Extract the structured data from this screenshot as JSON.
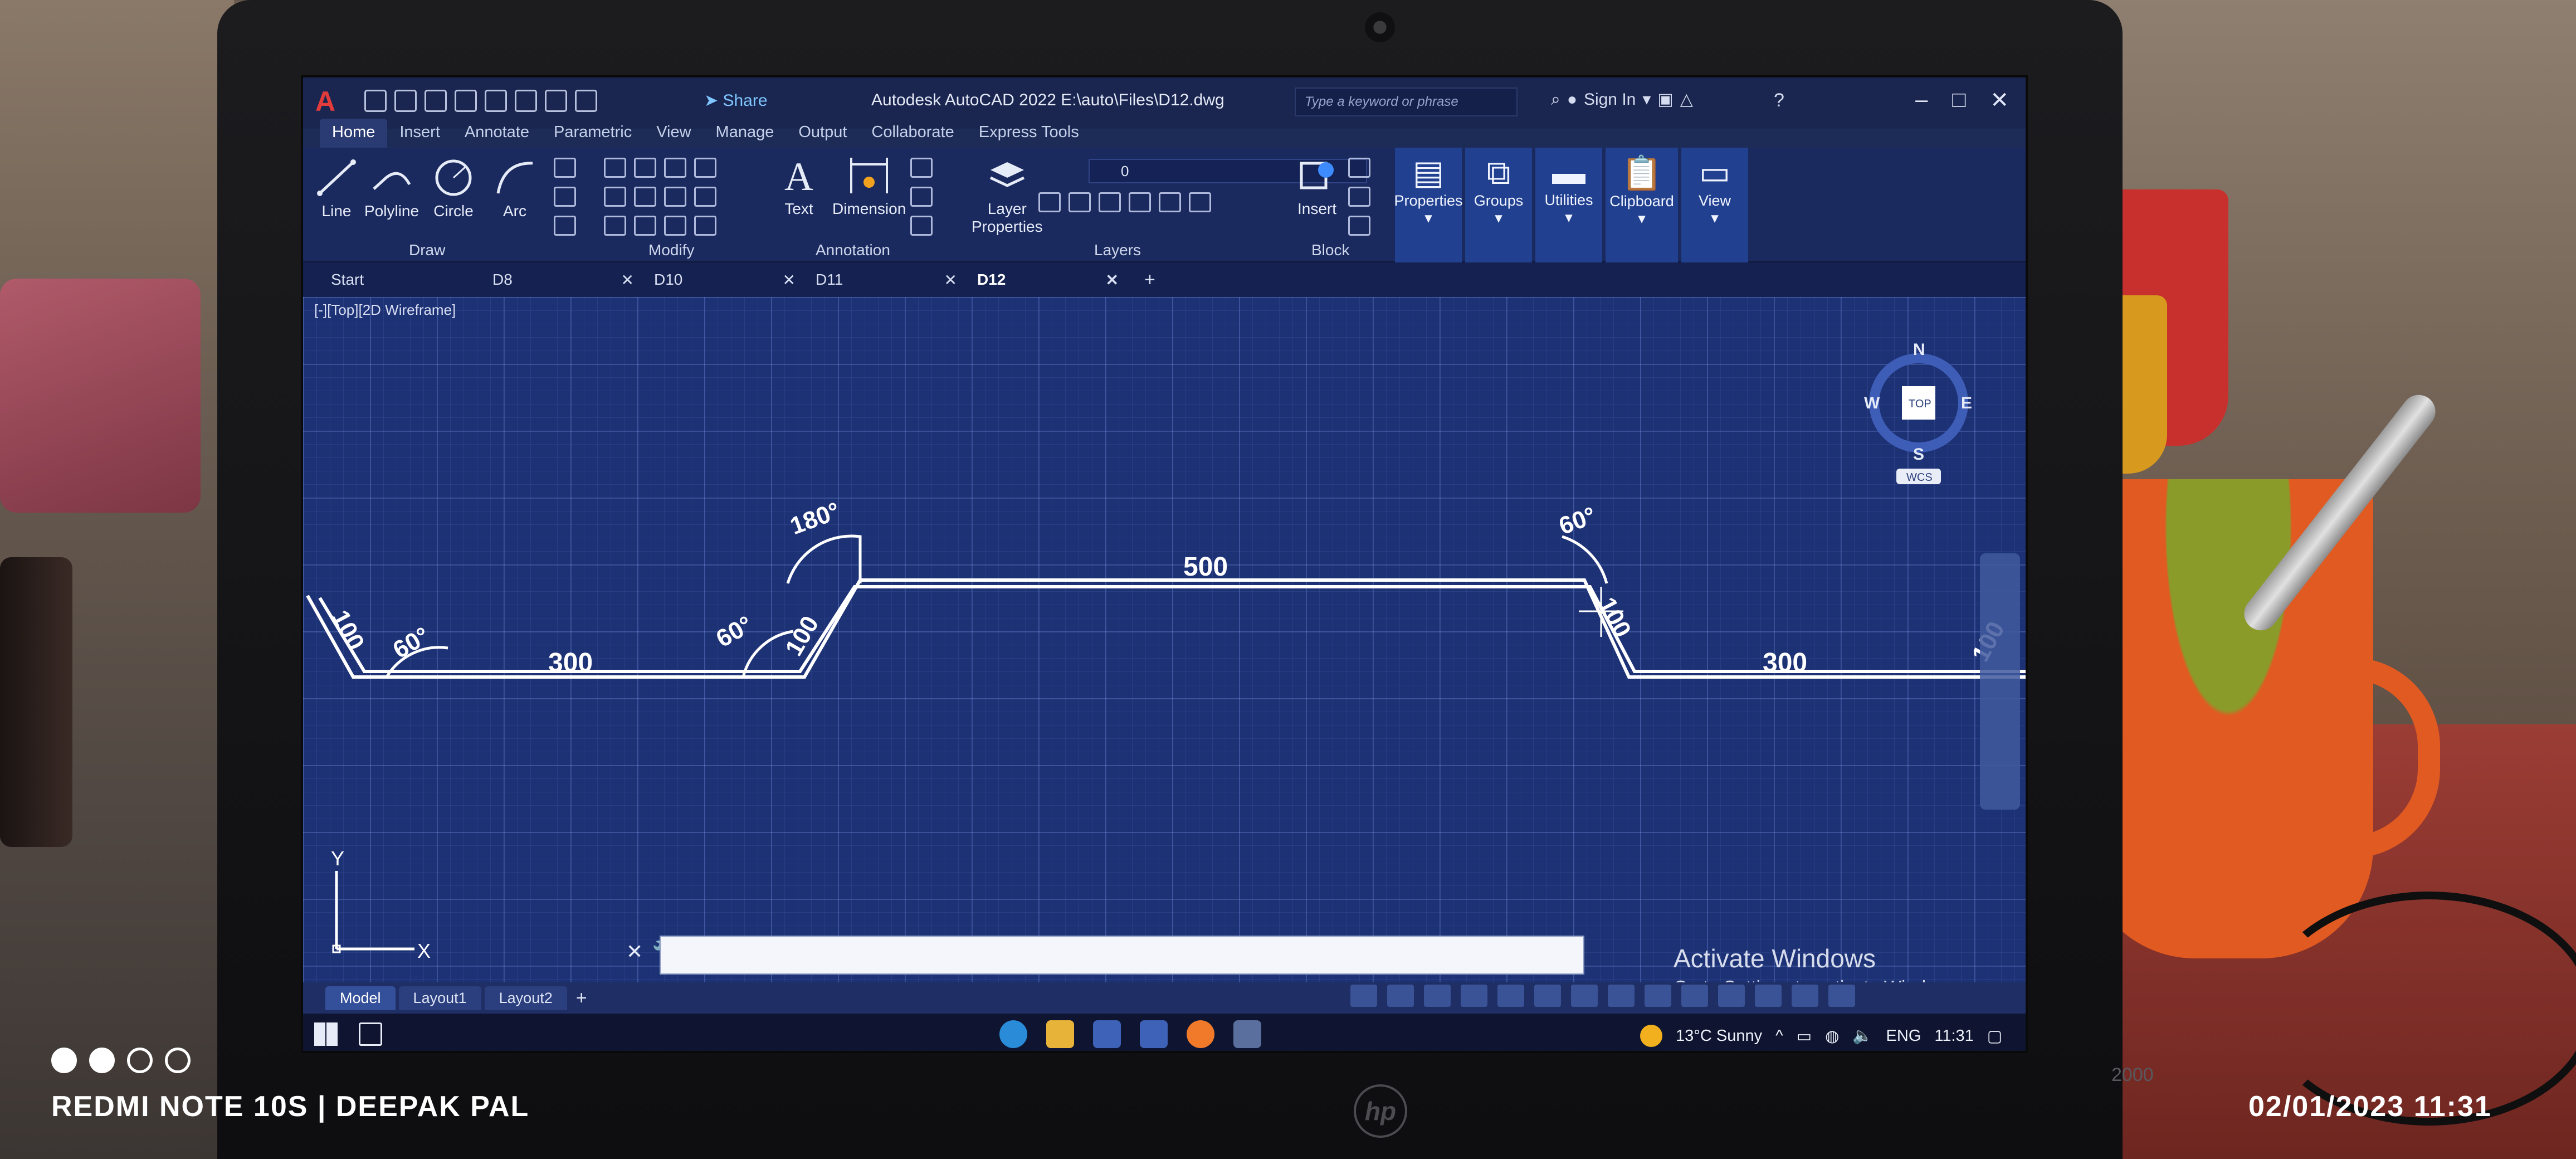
{
  "app": {
    "title": "Autodesk AutoCAD 2022   E:\\auto\\Files\\D12.dwg",
    "share_label": "Share",
    "search_placeholder": "Type a keyword or phrase",
    "signin_label": "Sign In"
  },
  "ribbon_tabs": [
    "Home",
    "Insert",
    "Annotate",
    "Parametric",
    "View",
    "Manage",
    "Output",
    "Collaborate",
    "Express Tools"
  ],
  "ribbon": {
    "draw": {
      "line": "Line",
      "polyline": "Polyline",
      "circle": "Circle",
      "arc": "Arc",
      "panel": "Draw"
    },
    "modify_panel": "Modify",
    "annotation": {
      "text": "Text",
      "dimension": "Dimension",
      "panel": "Annotation"
    },
    "layers": {
      "properties_line1": "Layer",
      "properties_line2": "Properties",
      "panel": "Layers",
      "current_layer": "0"
    },
    "block": {
      "insert": "Insert",
      "panel": "Block"
    },
    "groups": {
      "properties": "Properties",
      "groups": "Groups",
      "utilities": "Utilities",
      "clipboard": "Clipboard",
      "view": "View"
    }
  },
  "file_tabs": [
    {
      "label": "Start"
    },
    {
      "label": "D8"
    },
    {
      "label": "D10"
    },
    {
      "label": "D11"
    },
    {
      "label": "D12"
    }
  ],
  "viewport_label": "[-][Top][2D Wireframe]",
  "viewcube": {
    "n": "N",
    "s": "S",
    "e": "E",
    "w": "W",
    "top": "TOP",
    "wcs": "WCS"
  },
  "drawing": {
    "dimensions": {
      "left_edge": "100",
      "angle_left": "60°",
      "bottom_left": "300",
      "angle_left_up": "60°",
      "slope_left": "100",
      "angle_top_left": "180°",
      "top": "500",
      "angle_top_right": "60°",
      "slope_right": "100",
      "bottom_right": "300",
      "right_edge": "100"
    }
  },
  "ucs": {
    "x": "X",
    "y": "Y"
  },
  "watermark_activate": {
    "title": "Activate Windows",
    "subtitle": "Go to Settings to activate Windows."
  },
  "layout_tabs": [
    "Model",
    "Layout1",
    "Layout2"
  ],
  "taskbar": {
    "weather": "13°C  Sunny",
    "lang": "ENG",
    "time": "11:31"
  },
  "photo_overlay": {
    "device": "REDMI NOTE 10S | DEEPAK PAL",
    "datetime": "02/01/2023  11:31",
    "laptop_model": "2000"
  }
}
